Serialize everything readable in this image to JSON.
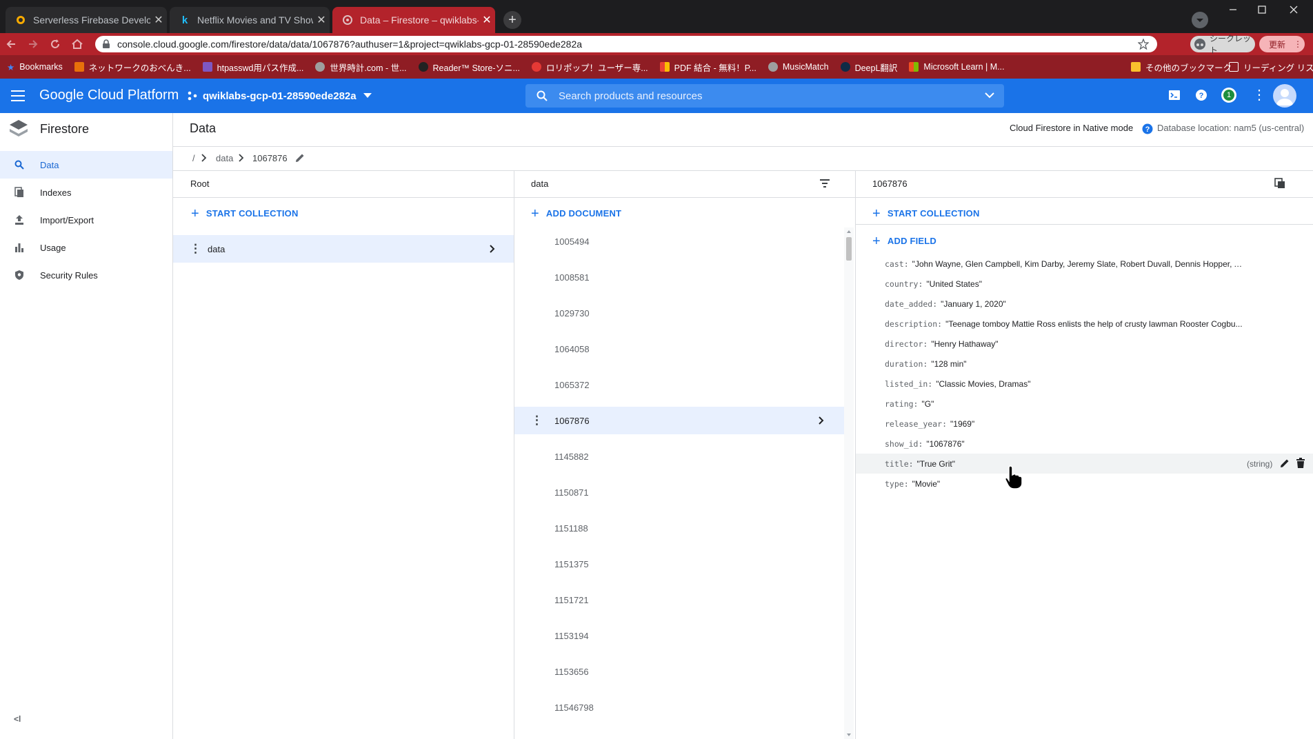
{
  "browser": {
    "tabs": [
      {
        "title": "Serverless Firebase Development",
        "close": "✕",
        "favicon_color": "#f9ab00"
      },
      {
        "title": "Netflix Movies and TV Shows | Ka",
        "close": "✕",
        "favicon_color": "#20beff"
      },
      {
        "title": "Data – Firestore – qwiklabs-gcp-",
        "close": "✕",
        "favicon_color": "#9aa0a6"
      }
    ],
    "url": "console.cloud.google.com/firestore/data/data/1067876?authuser=1&project=qwiklabs-gcp-01-28590ede282a",
    "incognito_label": "シークレット",
    "update_label": "更新",
    "bookmarks": [
      {
        "label": "Bookmarks",
        "color": "#4285f4"
      },
      {
        "label": "ネットワークのおべんき...",
        "color": "#e8710a"
      },
      {
        "label": "htpasswd用パス作成...",
        "color": "#7e57c2"
      },
      {
        "label": "世界時計.com - 世...",
        "color": "#9e9e9e"
      },
      {
        "label": "Reader™ Store-ソニ...",
        "color": "#222222"
      },
      {
        "label": "ロリポップ！ユーザー専...",
        "color": "#e53935"
      },
      {
        "label": "PDF 結合 - 無料！P...",
        "color": "#fbbc04"
      },
      {
        "label": "MusicMatch",
        "color": "#9e9e9e"
      },
      {
        "label": "DeepL翻訳",
        "color": "#0f2b46"
      },
      {
        "label": "Microsoft Learn | M...",
        "color": "#f25022"
      }
    ],
    "other_bookmarks": "その他のブックマーク",
    "reading_list": "リーディング リスト"
  },
  "gcp": {
    "brand": "Google Cloud Platform",
    "project": "qwiklabs-gcp-01-28590ede282a",
    "search_placeholder": "Search products and resources",
    "notification_count": "1"
  },
  "sidebar": {
    "product": "Firestore",
    "items": [
      {
        "label": "Data",
        "icon": "search-icon",
        "active": true
      },
      {
        "label": "Indexes",
        "icon": "indexes-icon",
        "active": false
      },
      {
        "label": "Import/Export",
        "icon": "import-export-icon",
        "active": false
      },
      {
        "label": "Usage",
        "icon": "bar-chart-icon",
        "active": false
      },
      {
        "label": "Security Rules",
        "icon": "shield-icon",
        "active": false
      }
    ],
    "collapse": "<l"
  },
  "page": {
    "title": "Data",
    "mode": "Cloud Firestore in Native mode",
    "location": "Database location: nam5 (us-central)",
    "breadcrumb": {
      "root": "/",
      "collection": "data",
      "document": "1067876"
    }
  },
  "root_panel": {
    "title": "Root",
    "action": "START COLLECTION",
    "collections": [
      "data"
    ]
  },
  "collection_panel": {
    "title": "data",
    "action": "ADD DOCUMENT",
    "selected": "1067876",
    "documents": [
      "1005494",
      "1008581",
      "1029730",
      "1064058",
      "1065372",
      "1067876",
      "1145882",
      "1150871",
      "1151188",
      "1151375",
      "1151721",
      "1153194",
      "1153656",
      "11546798"
    ]
  },
  "document_panel": {
    "title": "1067876",
    "action_collection": "START COLLECTION",
    "action_field": "ADD FIELD",
    "hover_type": "(string)",
    "fields": [
      {
        "key": "cast:",
        "value": "\"John Wayne, Glen Campbell, Kim Darby, Jeremy Slate, Robert Duvall, Dennis Hopper, Alfr..."
      },
      {
        "key": "country:",
        "value": "\"United States\""
      },
      {
        "key": "date_added:",
        "value": "\"January 1, 2020\""
      },
      {
        "key": "description:",
        "value": "\"Teenage tomboy Mattie Ross enlists the help of crusty lawman Rooster Cogbu..."
      },
      {
        "key": "director:",
        "value": "\"Henry Hathaway\""
      },
      {
        "key": "duration:",
        "value": "\"128 min\""
      },
      {
        "key": "listed_in:",
        "value": "\"Classic Movies, Dramas\""
      },
      {
        "key": "rating:",
        "value": "\"G\""
      },
      {
        "key": "release_year:",
        "value": "\"1969\""
      },
      {
        "key": "show_id:",
        "value": "\"1067876\""
      },
      {
        "key": "title:",
        "value": "\"True Grit\""
      },
      {
        "key": "type:",
        "value": "\"Movie\""
      }
    ]
  },
  "colors": {
    "accent": "#1a73e8",
    "chrome_red": "#b3232b"
  }
}
